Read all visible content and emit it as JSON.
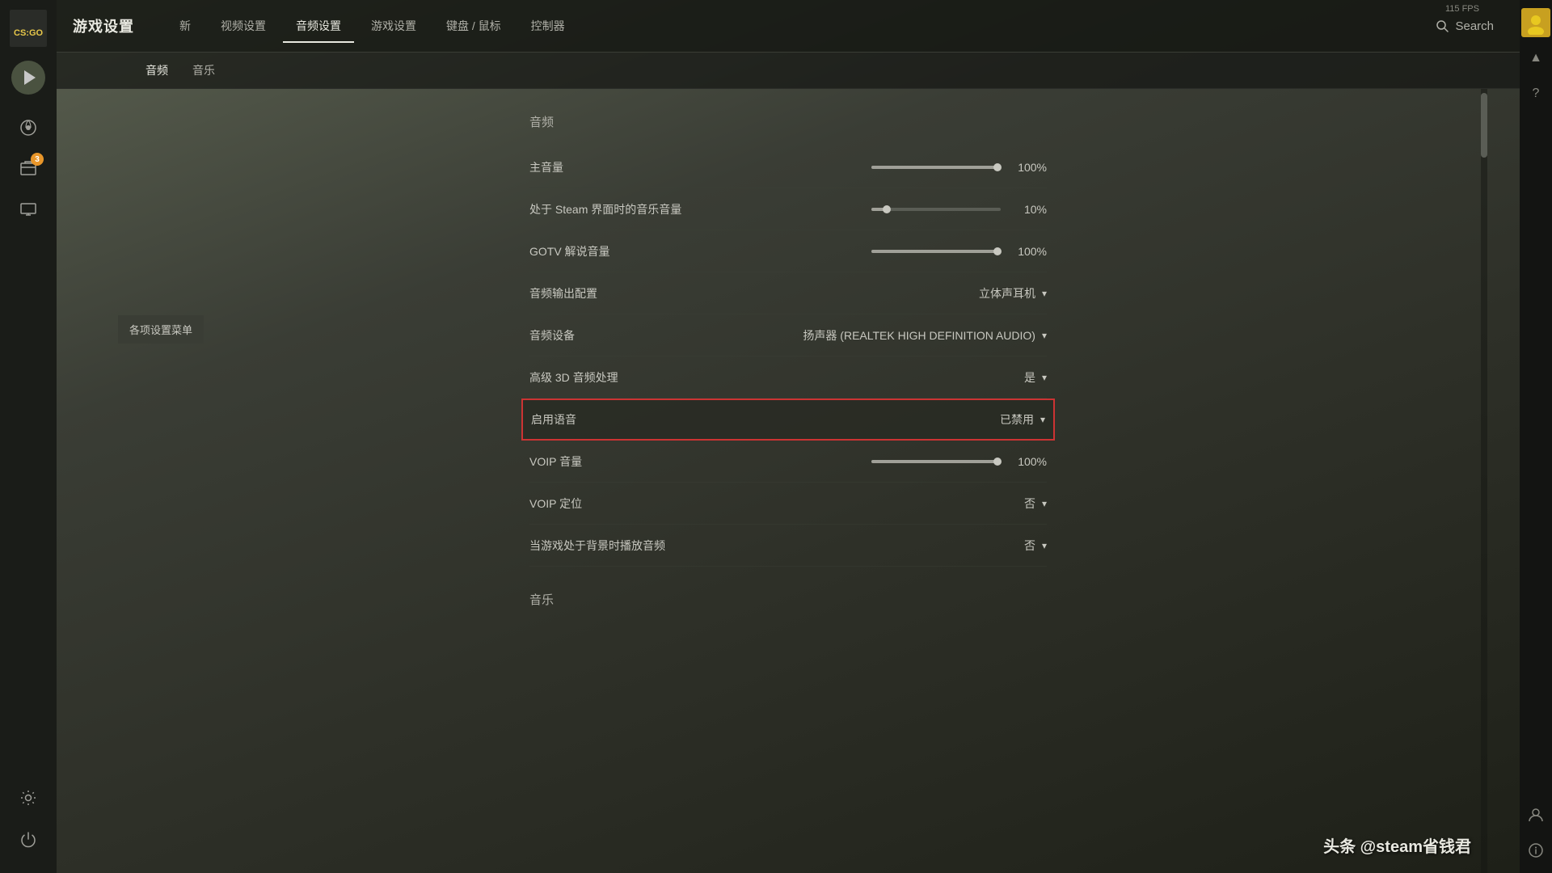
{
  "app": {
    "title": "游戏设置",
    "fps": "115 FPS"
  },
  "header": {
    "title": "游戏设置",
    "tabs": [
      {
        "id": "new",
        "label": "新",
        "active": false
      },
      {
        "id": "video",
        "label": "视频设置",
        "active": false
      },
      {
        "id": "audio",
        "label": "音频设置",
        "active": true
      },
      {
        "id": "game",
        "label": "游戏设置",
        "active": false
      },
      {
        "id": "keyboard",
        "label": "键盘 / 鼠标",
        "active": false
      },
      {
        "id": "controller",
        "label": "控制器",
        "active": false
      }
    ],
    "search_label": "Search"
  },
  "sub_tabs": [
    {
      "id": "audio",
      "label": "音频",
      "active": true
    },
    {
      "id": "music",
      "label": "音乐",
      "active": false
    }
  ],
  "sections": [
    {
      "id": "audio_section",
      "title": "音频",
      "settings": [
        {
          "id": "master_volume",
          "label": "主音量",
          "type": "slider",
          "value": "100%",
          "fill_pct": 100,
          "highlighted": false
        },
        {
          "id": "steam_ui_music",
          "label": "处于 Steam 界面时的音乐音量",
          "type": "slider",
          "value": "10%",
          "fill_pct": 10,
          "highlighted": false
        },
        {
          "id": "gotv_volume",
          "label": "GOTV 解说音量",
          "type": "slider",
          "value": "100%",
          "fill_pct": 100,
          "highlighted": false
        },
        {
          "id": "audio_output",
          "label": "音频输出配置",
          "type": "dropdown",
          "value": "立体声耳机",
          "highlighted": false
        },
        {
          "id": "audio_device",
          "label": "音频设备",
          "type": "dropdown",
          "value": "扬声器 (REALTEK HIGH DEFINITION AUDIO)",
          "highlighted": false
        },
        {
          "id": "3d_audio",
          "label": "高级 3D 音频处理",
          "type": "dropdown",
          "value": "是",
          "highlighted": false
        },
        {
          "id": "enable_voice",
          "label": "启用语音",
          "type": "dropdown",
          "value": "已禁用",
          "highlighted": true
        },
        {
          "id": "voip_volume",
          "label": "VOIP 音量",
          "type": "slider",
          "value": "100%",
          "fill_pct": 100,
          "highlighted": false
        },
        {
          "id": "voip_positioning",
          "label": "VOIP 定位",
          "type": "dropdown",
          "value": "否",
          "highlighted": false
        },
        {
          "id": "bg_audio",
          "label": "当游戏处于背景时播放音频",
          "type": "dropdown",
          "value": "否",
          "highlighted": false
        }
      ]
    },
    {
      "id": "music_section",
      "title": "音乐",
      "settings": []
    }
  ],
  "sidebar": {
    "settings_menu_label": "各项设置菜单",
    "badge_count": "3"
  },
  "right_sidebar": {
    "icons": [
      "▲",
      "?",
      "👤",
      "ℹ"
    ]
  },
  "watermark": "头条 @steam省钱君"
}
